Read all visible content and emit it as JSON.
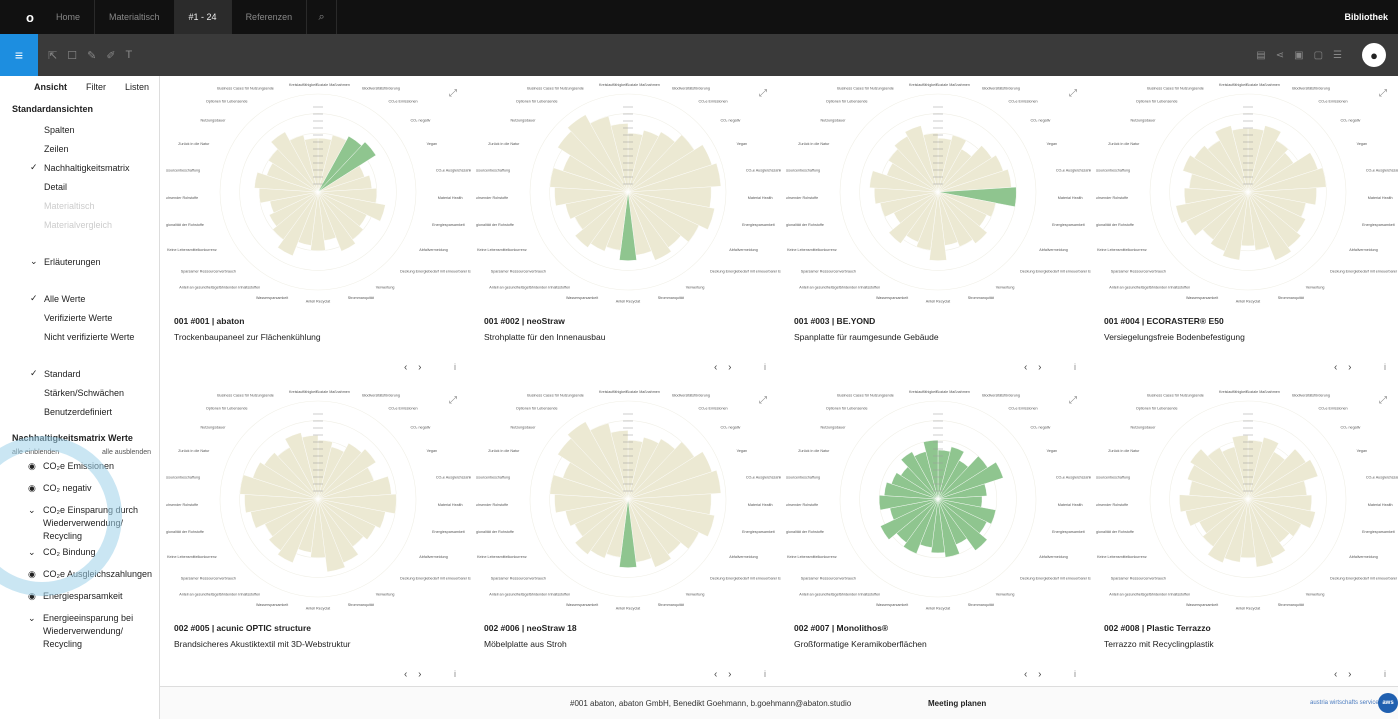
{
  "nav": {
    "logo": "o",
    "tabs": [
      {
        "label": "Home"
      },
      {
        "label": "Materialtisch"
      },
      {
        "label": "#1 - 24"
      },
      {
        "label": "Referenzen"
      }
    ],
    "search_icon": "search-icon",
    "library": "Bibliothek"
  },
  "toolbar": {
    "menu_icon": "hamburger-icon",
    "tools": [
      "cursor-icon",
      "comment-icon",
      "pen-icon",
      "pencil-icon",
      "text-icon"
    ],
    "right_icons": [
      "bookmark-icon",
      "share-icon",
      "print-icon",
      "document-icon",
      "list-icon"
    ],
    "avatar_icon": "user-avatar-icon"
  },
  "sidebar": {
    "tabs": [
      {
        "label": "Ansicht"
      },
      {
        "label": "Filter"
      },
      {
        "label": "Listen"
      }
    ],
    "standard_heading": "Standardansichten",
    "views": [
      {
        "label": "Spalten",
        "mark": ""
      },
      {
        "label": "Zeilen",
        "mark": ""
      },
      {
        "label": "Nachhaltigkeitsmatrix",
        "mark": "✓"
      },
      {
        "label": "Detail",
        "mark": ""
      },
      {
        "label": "Materialtisch",
        "mark": ""
      },
      {
        "label": "Materialvergleich",
        "mark": ""
      }
    ],
    "explanations": {
      "label": "Erläuterungen",
      "mark": "⌄"
    },
    "values": [
      {
        "label": "Alle Werte",
        "mark": "✓"
      },
      {
        "label": "Verifizierte Werte",
        "mark": ""
      },
      {
        "label": "Nicht verifizierte Werte",
        "mark": ""
      }
    ],
    "modes": [
      {
        "label": "Standard",
        "mark": "✓"
      },
      {
        "label": "Stärken/Schwächen",
        "mark": ""
      },
      {
        "label": "Benutzerdefiniert",
        "mark": ""
      }
    ],
    "matrix_heading": "Nachhaltigkeitsmatrix Werte",
    "show_all": "alle einblenden",
    "hide_all": "alle ausblenden",
    "matrix_values": [
      {
        "mark": "◉",
        "label": "CO₂e Emissionen"
      },
      {
        "mark": "◉",
        "label": "CO₂ negativ"
      },
      {
        "mark": "⌄",
        "label": "CO₂e Einsparung durch Wiederverwendung/ Recycling"
      },
      {
        "mark": "⌄",
        "label": "CO₂ Bindung"
      },
      {
        "mark": "◉",
        "label": "CO₂e Ausgleichszahlungen"
      },
      {
        "mark": "◉",
        "label": "Energiesparsamkeit"
      },
      {
        "mark": "⌄",
        "label": "Energieeinsparung bei Wiederverwendung/ Recycling"
      }
    ]
  },
  "radar_labels": [
    "Soziale Maßnahmen",
    "Biodiversitätsförderung",
    "CO₂e Emissionen",
    "CO₂ negativ",
    "Vegan",
    "CO₂e Ausgleichszahlungen",
    "Material Health",
    "Energiesparsamkeit",
    "Abfallvermeidung",
    "Deckung Energiebedarf mit erneuerbarer Energie",
    "Verwertung",
    "Strommanquität",
    "Anteil Recyclat",
    "Wassersparsamkeit",
    "Anteil an gesundheitsgefährdenden Inhaltsstoffen",
    "Sparsamer Ressourcenverbrauch",
    "Keine Lebensmittelkonkurrenz",
    "Regionalität der Rohstoffe",
    "Bestandteil nachwachsender Rohstoffe",
    "Verantwortungsbewusste Ressourcenbeschaffung",
    "Zurück in die Natur",
    "Nutzungsdauer",
    "Optionen für Lebensende",
    "Business Cases für Nutzungsende",
    "Kreislauffähigkeit"
  ],
  "materials": [
    {
      "title": "001 #001 | abaton",
      "subtitle": "Trockenbaupaneel zur Flächenkühlung",
      "values": [
        0.55,
        0.6,
        0.65,
        0.7,
        0.5,
        0.55,
        0.6,
        0.7,
        0.55,
        0.6,
        0.65,
        0.5,
        0.6,
        0.55,
        0.7,
        0.6,
        0.55,
        0.5,
        0.6,
        0.65,
        0.55,
        0.6,
        0.7,
        0.6,
        0.55
      ],
      "highlight": [
        2,
        3
      ]
    },
    {
      "title": "001 #002 | neoStraw",
      "subtitle": "Strohplatte für den Innenausbau",
      "values": [
        0.6,
        0.65,
        0.7,
        0.8,
        0.9,
        0.95,
        0.85,
        0.9,
        0.8,
        0.7,
        0.75,
        0.65,
        0.7,
        0.6,
        0.65,
        0.7,
        0.6,
        0.65,
        0.75,
        0.8,
        0.7,
        0.85,
        0.9,
        0.8,
        0.7
      ],
      "highlight": [
        12
      ]
    },
    {
      "title": "001 #003 | BE.YOND",
      "subtitle": "Spanplatte für raumgesunde Gebäude",
      "values": [
        0.55,
        0.6,
        0.5,
        0.65,
        0.7,
        0.75,
        0.8,
        0.6,
        0.55,
        0.65,
        0.6,
        0.55,
        0.7,
        0.6,
        0.55,
        0.65,
        0.5,
        0.6,
        0.65,
        0.7,
        0.55,
        0.6,
        0.65,
        0.7,
        0.6
      ],
      "highlight": [
        6
      ]
    },
    {
      "title": "001 #004 | ECORASTER® E50",
      "subtitle": "Versiegelungsfreie Bodenbefestigung",
      "values": [
        0.65,
        0.7,
        0.6,
        0.55,
        0.75,
        0.8,
        0.7,
        0.6,
        0.65,
        0.7,
        0.75,
        0.6,
        0.55,
        0.7,
        0.65,
        0.6,
        0.7,
        0.75,
        0.65,
        0.6,
        0.7,
        0.65,
        0.6,
        0.7,
        0.65
      ],
      "highlight": []
    },
    {
      "title": "002 #005 | acunic OPTIC structure",
      "subtitle": "Brandsicheres Akustiktextil mit 3D-Webstruktur",
      "values": [
        0.6,
        0.55,
        0.65,
        0.7,
        0.6,
        0.75,
        0.8,
        0.7,
        0.65,
        0.6,
        0.7,
        0.75,
        0.6,
        0.55,
        0.7,
        0.65,
        0.6,
        0.7,
        0.75,
        0.8,
        0.7,
        0.65,
        0.6,
        0.7,
        0.65
      ],
      "highlight": []
    },
    {
      "title": "002 #006 | neoStraw 18",
      "subtitle": "Möbelplatte aus Stroh",
      "values": [
        0.6,
        0.65,
        0.7,
        0.8,
        0.9,
        0.95,
        0.85,
        0.9,
        0.8,
        0.7,
        0.75,
        0.65,
        0.7,
        0.6,
        0.65,
        0.7,
        0.6,
        0.65,
        0.75,
        0.8,
        0.7,
        0.85,
        0.9,
        0.8,
        0.7
      ],
      "highlight": [
        12
      ]
    },
    {
      "title": "002 #007 | Monolithos®",
      "subtitle": "Großformatige Keramikoberflächen",
      "values": [
        0.5,
        0.55,
        0.45,
        0.6,
        0.7,
        0.5,
        0.45,
        0.6,
        0.55,
        0.65,
        0.5,
        0.6,
        0.55,
        0.5,
        0.6,
        0.55,
        0.65,
        0.5,
        0.6,
        0.55,
        0.5,
        0.45,
        0.55,
        0.5,
        0.6
      ],
      "highlight": [
        0,
        1,
        2,
        3,
        4,
        5,
        6,
        7,
        8,
        9,
        10,
        11,
        12,
        13,
        14,
        15,
        16,
        17,
        18,
        19,
        20,
        21,
        22,
        23,
        24
      ]
    },
    {
      "title": "002 #008 | Plastic Terrazzo",
      "subtitle": "Terrazzo mit Recyclingplastik",
      "values": [
        0.6,
        0.65,
        0.55,
        0.7,
        0.75,
        0.6,
        0.65,
        0.7,
        0.6,
        0.55,
        0.65,
        0.7,
        0.6,
        0.65,
        0.7,
        0.6,
        0.55,
        0.65,
        0.7,
        0.6,
        0.65,
        0.7,
        0.6,
        0.55,
        0.65
      ],
      "highlight": []
    }
  ],
  "card_nav": "‹ ›",
  "card_info": "i",
  "card_expand": "⤢",
  "footer": {
    "contact": "#001 abaton, abaton GmbH, Benedikt Goehmann, b.goehmann@abaton.studio",
    "meeting": "Meeting planen",
    "partner": "austria wirtschafts service",
    "logo": "aws"
  },
  "colors": {
    "fill": "#ece9d3",
    "highlight": "#8fc58f",
    "accent": "#1d8ee0"
  }
}
